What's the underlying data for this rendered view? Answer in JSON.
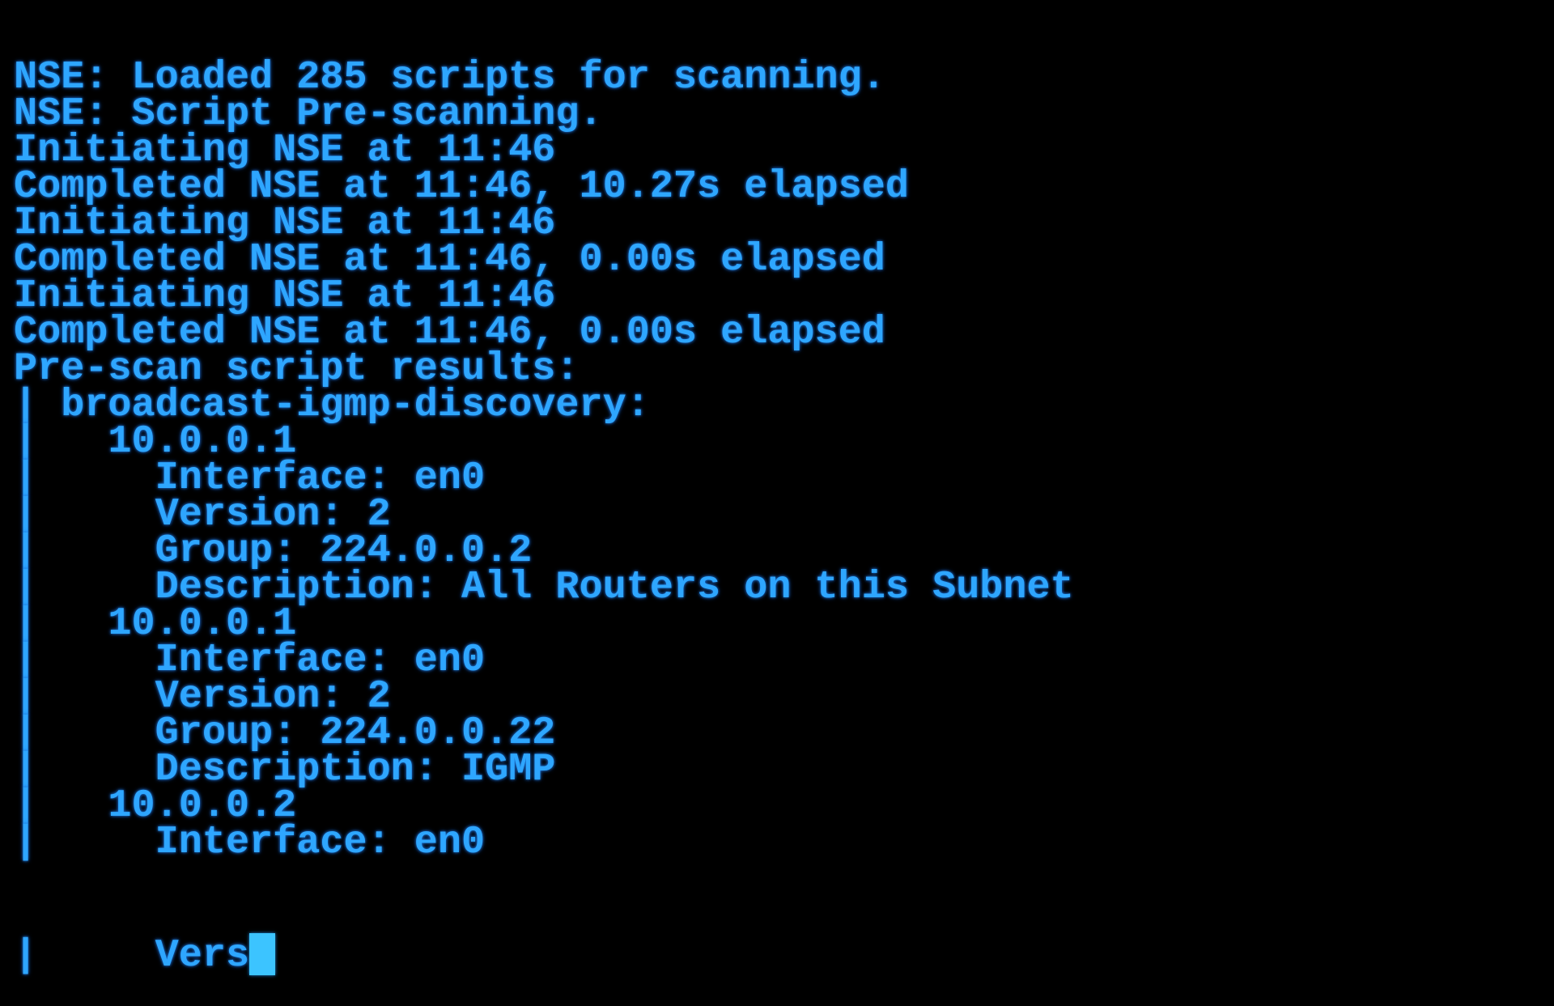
{
  "terminal": {
    "lines": [
      "NSE: Loaded 285 scripts for scanning.",
      "NSE: Script Pre-scanning.",
      "Initiating NSE at 11:46",
      "Completed NSE at 11:46, 10.27s elapsed",
      "Initiating NSE at 11:46",
      "Completed NSE at 11:46, 0.00s elapsed",
      "Initiating NSE at 11:46",
      "Completed NSE at 11:46, 0.00s elapsed",
      "Pre-scan script results:",
      "| broadcast-igmp-discovery:",
      "|   10.0.0.1",
      "|     Interface: en0",
      "|     Version: 2",
      "|     Group: 224.0.0.2",
      "|     Description: All Routers on this Subnet",
      "|   10.0.0.1",
      "|     Interface: en0",
      "|     Version: 2",
      "|     Group: 224.0.0.22",
      "|     Description: IGMP",
      "|   10.0.0.2",
      "|     Interface: en0"
    ],
    "current_line": "|     Vers",
    "text_color": "#2ea6ff",
    "cursor_color": "#3cc4ff",
    "background": "#000000"
  }
}
